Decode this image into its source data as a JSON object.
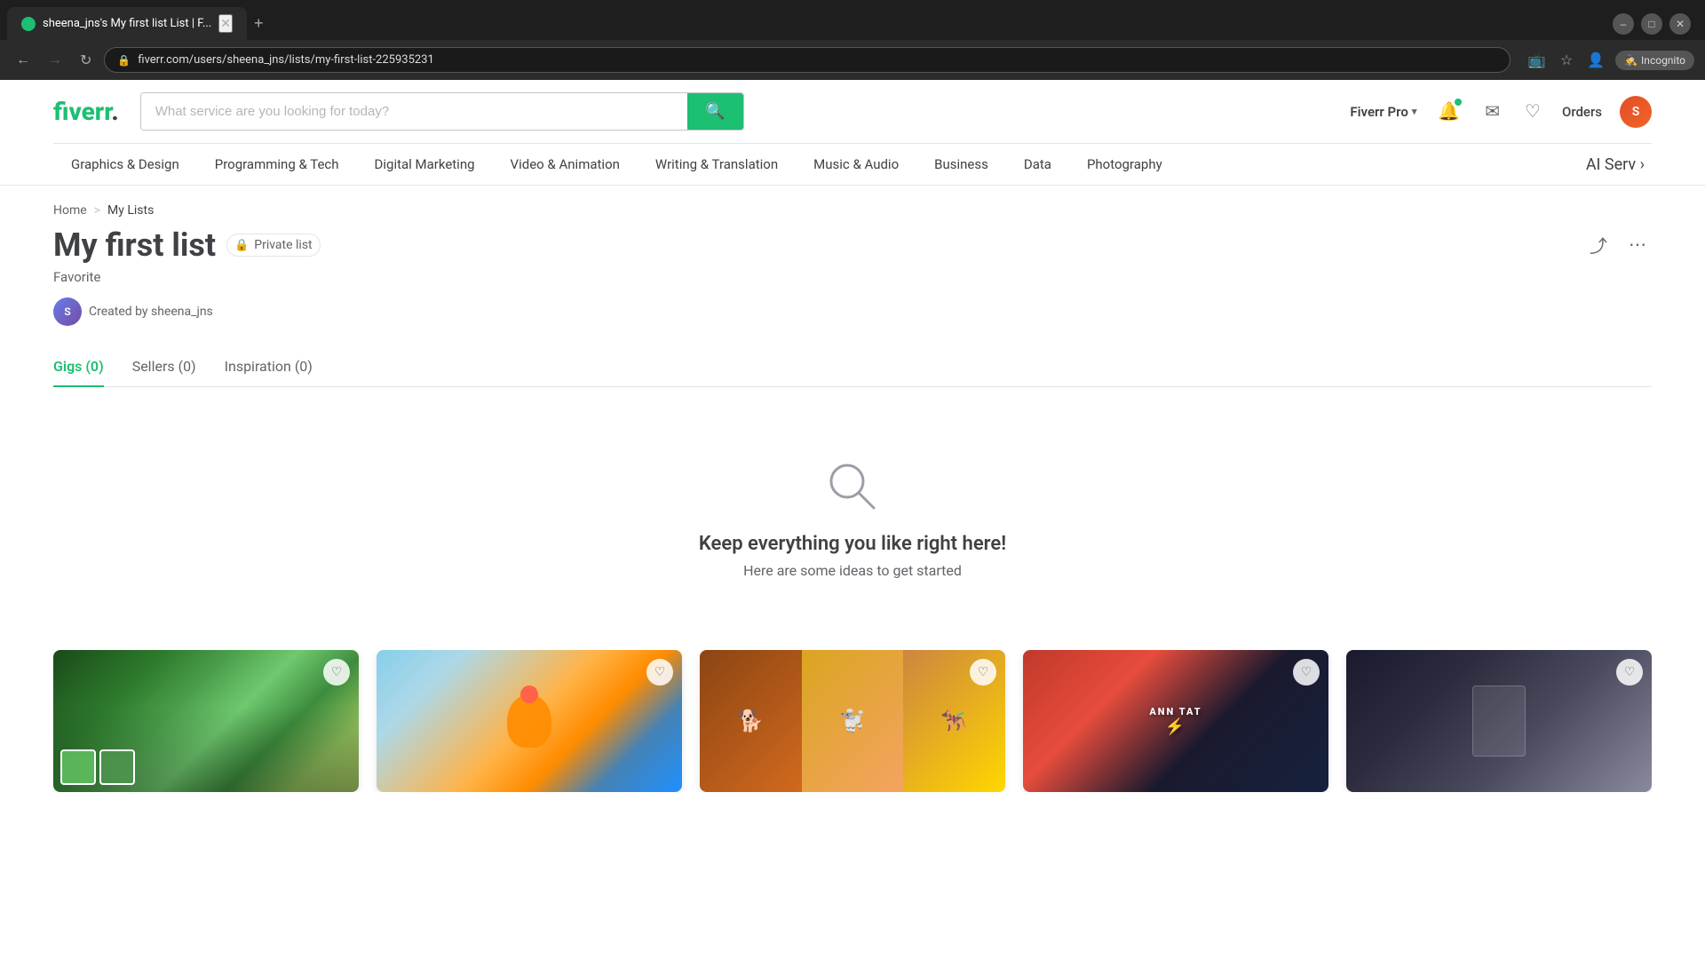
{
  "browser": {
    "tab_title": "sheena_jns's My first list List | F...",
    "url": "fiverr.com/users/sheena_jns/lists/my-first-list-225935231",
    "new_tab_label": "+",
    "incognito_label": "Incognito"
  },
  "header": {
    "logo": "fiverr",
    "search_placeholder": "What service are you looking for today?",
    "fiverr_pro": "Fiverr Pro",
    "orders": "Orders",
    "user_initials": "S"
  },
  "nav": {
    "items": [
      "Graphics & Design",
      "Programming & Tech",
      "Digital Marketing",
      "Video & Animation",
      "Writing & Translation",
      "Music & Audio",
      "Business",
      "Data",
      "Photography",
      "AI Serv"
    ]
  },
  "breadcrumb": {
    "home": "Home",
    "separator": ">",
    "current": "My Lists"
  },
  "list": {
    "title": "My first list",
    "private_label": "Private list",
    "subtitle": "Favorite",
    "creator_label": "Created by sheena_jns"
  },
  "tabs": [
    {
      "label": "Gigs (0)",
      "active": true
    },
    {
      "label": "Sellers (0)",
      "active": false
    },
    {
      "label": "Inspiration (0)",
      "active": false
    }
  ],
  "empty_state": {
    "title": "Keep everything you like right here!",
    "subtitle": "Here are some ideas to get started"
  },
  "cards": [
    {
      "id": 1,
      "style": "card-img-1"
    },
    {
      "id": 2,
      "style": "card-img-2"
    },
    {
      "id": 3,
      "style": "card-img-3"
    },
    {
      "id": 4,
      "style": "card-img-4"
    },
    {
      "id": 5,
      "style": "card-img-5"
    }
  ]
}
